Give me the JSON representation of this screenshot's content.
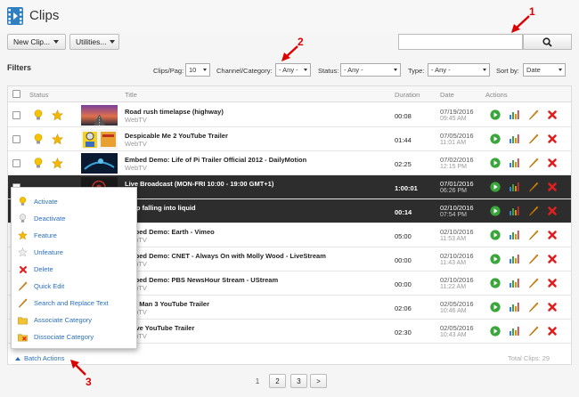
{
  "header": {
    "title": "Clips"
  },
  "toolbar": {
    "new_clip_label": "New Clip...",
    "utilities_label": "Utilities..."
  },
  "search": {
    "value": "",
    "placeholder": ""
  },
  "filters": {
    "heading": "Filters",
    "clips_per_page_label": "Clips/Pag:",
    "clips_per_page_value": "10",
    "channel_label": "Channel/Category:",
    "channel_value": "- Any -",
    "status_label": "Status:",
    "status_value": "- Any -",
    "type_label": "Type:",
    "type_value": "- Any -",
    "sort_label": "Sort by:",
    "sort_value": "Date"
  },
  "table": {
    "columns": {
      "status": "Status",
      "title": "Title",
      "duration": "Duration",
      "date": "Date",
      "actions": "Actions"
    },
    "rows": [
      {
        "title": "Road rush timelapse (highway)",
        "source": "WebTV",
        "duration": "00:08",
        "date": "07/19/2016",
        "time": "09:45 AM"
      },
      {
        "title": "Despicable Me 2 YouTube Trailer",
        "source": "WebTV",
        "duration": "01:44",
        "date": "07/05/2016",
        "time": "11:01 AM"
      },
      {
        "title": "Embed Demo: Life of Pi Trailer Official 2012 - DailyMotion",
        "source": "WebTV",
        "duration": "02:25",
        "date": "07/02/2016",
        "time": "12:15 PM"
      },
      {
        "title": "Live Broadcast (MON-FRI 10:00 - 19:00 GMT+1)",
        "source": "",
        "duration": "1:00:01",
        "date": "07/01/2016",
        "time": "06:26 PM"
      },
      {
        "title": "Drop falling into liquid",
        "source": "",
        "duration": "00:14",
        "date": "02/10/2016",
        "time": "07:54 PM"
      },
      {
        "title": "Embed Demo: Earth - Vimeo",
        "source": "WebTV",
        "duration": "05:00",
        "date": "02/10/2016",
        "time": "11:53 AM"
      },
      {
        "title": "Embed Demo: CNET - Always On with Molly Wood - LiveStream",
        "source": "WebTV",
        "duration": "00:00",
        "date": "02/10/2016",
        "time": "11:43 AM"
      },
      {
        "title": "Embed Demo: PBS NewsHour Stream - UStream",
        "source": "WebTV",
        "duration": "00:00",
        "date": "02/10/2016",
        "time": "11:22 AM"
      },
      {
        "title": "Iron Man 3 YouTube Trailer",
        "source": "WebTV",
        "duration": "02:06",
        "date": "02/05/2016",
        "time": "10:46 AM"
      },
      {
        "title": "Brave YouTube Trailer",
        "source": "WebTV",
        "duration": "02:30",
        "date": "02/05/2016",
        "time": "10:43 AM"
      }
    ]
  },
  "batch_menu": {
    "items": [
      {
        "label": "Activate"
      },
      {
        "label": "Deactivate"
      },
      {
        "label": "Feature"
      },
      {
        "label": "Unfeature"
      },
      {
        "label": "Delete"
      },
      {
        "label": "Quick Edit"
      },
      {
        "label": "Search and Replace Text"
      },
      {
        "label": "Associate Category"
      },
      {
        "label": "Dissociate Category"
      }
    ]
  },
  "footer": {
    "batch_actions_label": "Batch Actions",
    "total_label": "Total Clips: 29"
  },
  "pagination": {
    "pages": [
      "1",
      "2",
      "3"
    ],
    "next_label": ">"
  },
  "callouts": {
    "one": "1",
    "two": "2",
    "three": "3"
  },
  "colors": {
    "accent": "#2a6ebb",
    "dark_row": "#2d2d2d",
    "callout": "#dd0000",
    "play": "#3aa53a",
    "delete": "#e02020",
    "edit": "#f0a020"
  }
}
